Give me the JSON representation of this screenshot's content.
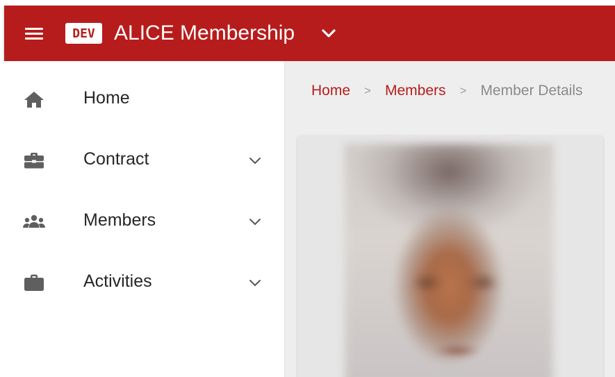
{
  "appbar": {
    "env_badge": "DEV",
    "title": "ALICE Membership",
    "color": "#b71c1c"
  },
  "sidebar": {
    "items": [
      {
        "label": "Home",
        "icon": "home-icon",
        "has_children": false
      },
      {
        "label": "Contract",
        "icon": "contract-icon",
        "has_children": true
      },
      {
        "label": "Members",
        "icon": "members-icon",
        "has_children": true
      },
      {
        "label": "Activities",
        "icon": "activities-icon",
        "has_children": true
      }
    ]
  },
  "breadcrumb": {
    "items": [
      "Home",
      "Members",
      "Member Details"
    ],
    "separator": ">"
  },
  "member": {
    "photo": "member-photo"
  }
}
